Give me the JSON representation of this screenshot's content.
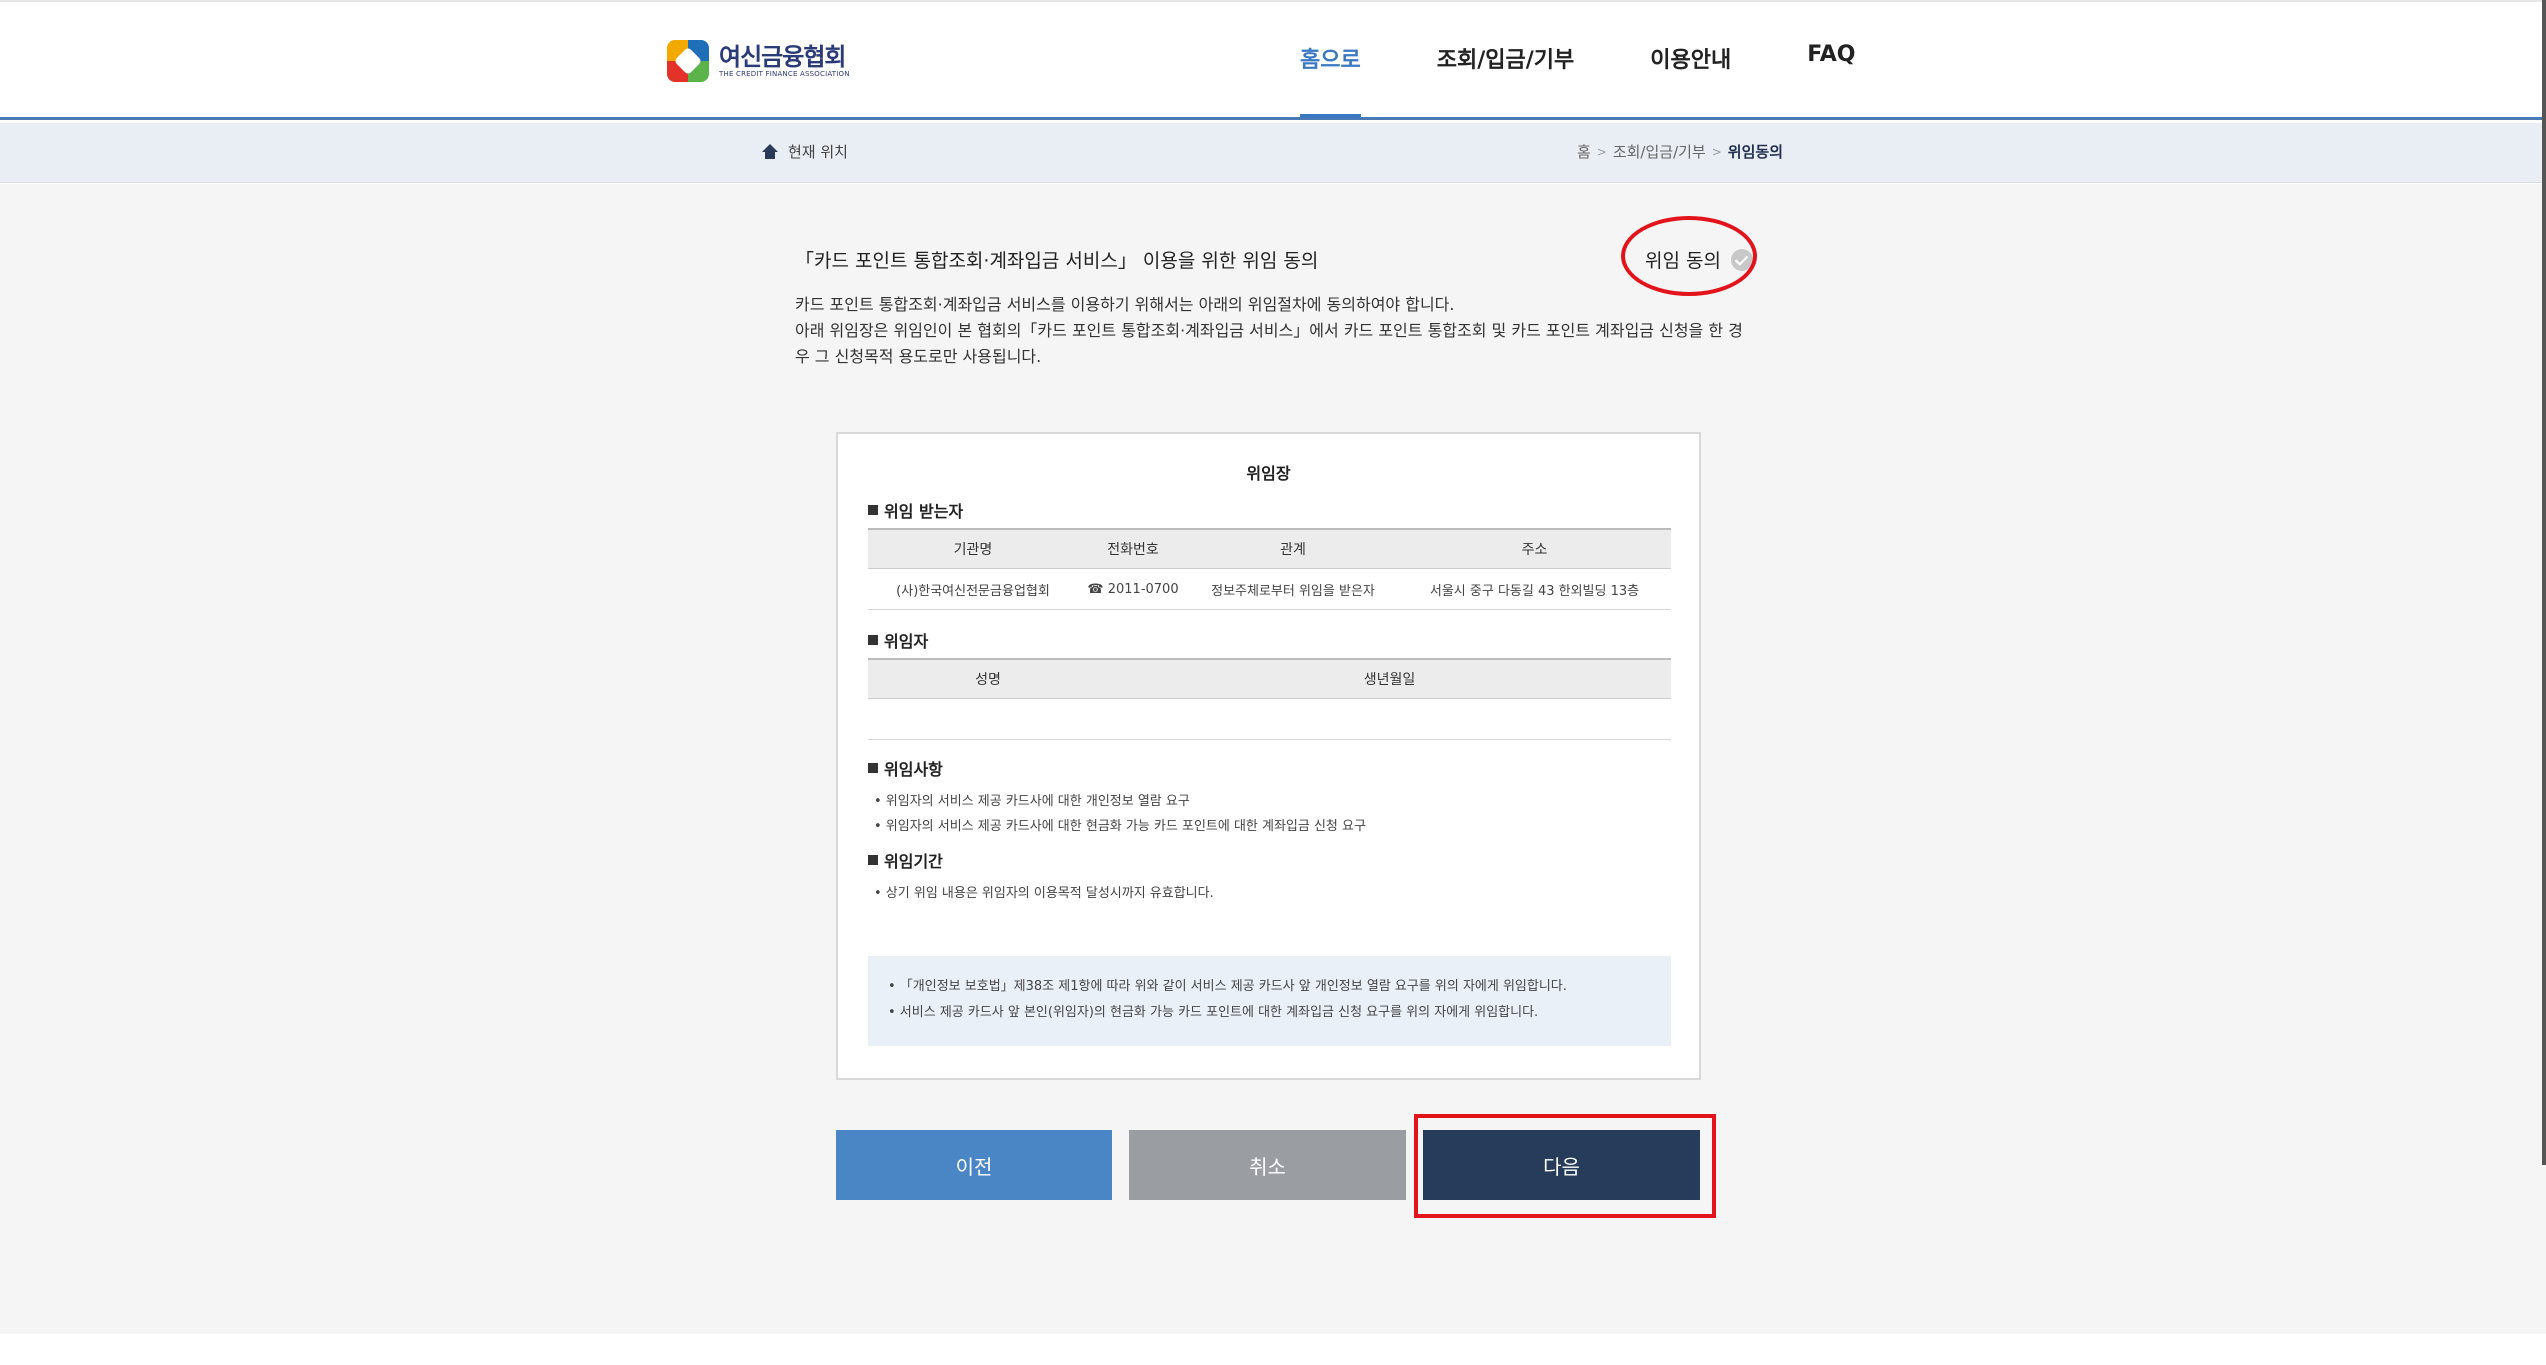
{
  "header": {
    "logo_ko": "여신금융협회",
    "logo_en": "THE CREDIT FINANCE ASSOCIATION",
    "nav": [
      {
        "label": "홈으로"
      },
      {
        "label": "조회/입금/기부"
      },
      {
        "label": "이용안내"
      },
      {
        "label": "FAQ"
      }
    ]
  },
  "breadcrumb": {
    "location_label": "현재 위치",
    "home": "홈",
    "level1": "조회/입금/기부",
    "current": "위임동의"
  },
  "consent": {
    "title": "「카드 포인트 통합조회·계좌입금 서비스」 이용을 위한 위임 동의",
    "check_label": "위임 동의",
    "desc_line1": "카드 포인트 통합조회·계좌입금 서비스를 이용하기 위해서는 아래의 위임절차에 동의하여야 합니다.",
    "desc_line2": "아래 위임장은 위임인이 본 협회의「카드 포인트 통합조회·계좌입금 서비스」에서 카드 포인트 통합조회 및 카드 포인트 계좌입금 신청을 한 경우 그 신청목적 용도로만 사용됩니다."
  },
  "document": {
    "title": "위임장",
    "receiver": {
      "title": "위임 받는자",
      "headers": [
        "기관명",
        "전화번호",
        "관계",
        "주소"
      ],
      "row": [
        "(사)한국여신전문금융업협회",
        "☎ 2011-0700",
        "정보주체로부터 위임을 받은자",
        "서울시 중구 다동길 43 한외빌딩 13층"
      ]
    },
    "delegator": {
      "title": "위임자",
      "headers": [
        "성명",
        "생년월일"
      ]
    },
    "items": {
      "title": "위임사항",
      "lines": [
        "• 위임자의 서비스 제공 카드사에 대한 개인정보 열람 요구",
        "• 위임자의 서비스 제공 카드사에 대한 현금화 가능 카드 포인트에 대한 계좌입금 신청 요구"
      ]
    },
    "period": {
      "title": "위임기간",
      "lines": [
        "• 상기 위임 내용은 위임자의 이용목적 달성시까지 유효합니다."
      ]
    },
    "notice": [
      "• 「개인정보 보호법」제38조 제1항에 따라 위와 같이 서비스 제공 카드사 앞 개인정보 열람 요구를 위의 자에게 위임합니다.",
      "• 서비스 제공 카드사 앞 본인(위임자)의 현금화 가능 카드 포인트에 대한 계좌입금 신청 요구를 위의 자에게 위임합니다."
    ]
  },
  "buttons": {
    "prev": "이전",
    "cancel": "취소",
    "next": "다음"
  },
  "colors": {
    "brand_blue": "#3a78c2",
    "prev_button": "#4a86c6",
    "cancel_button": "#9a9ea3",
    "next_button": "#273c5a",
    "highlight_red": "#e3131b"
  }
}
